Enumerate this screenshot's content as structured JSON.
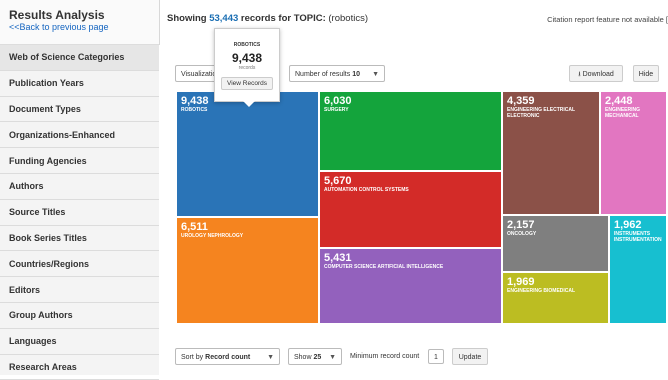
{
  "sidebar": {
    "title": "Results Analysis",
    "back_link": "<<Back to previous page",
    "items": [
      {
        "label": "Web of Science Categories",
        "active": true
      },
      {
        "label": "Publication Years"
      },
      {
        "label": "Document Types"
      },
      {
        "label": "Organizations-Enhanced"
      },
      {
        "label": "Funding Agencies"
      },
      {
        "label": "Authors"
      },
      {
        "label": "Source Titles"
      },
      {
        "label": "Book Series Titles"
      },
      {
        "label": "Countries/Regions"
      },
      {
        "label": "Editors"
      },
      {
        "label": "Group Authors"
      },
      {
        "label": "Languages"
      },
      {
        "label": "Research Areas"
      }
    ]
  },
  "header": {
    "prefix": "Showing",
    "count": "53,443",
    "middle": "records for TOPIC:",
    "query": "(robotics)",
    "note": "Citation report feature not available ["
  },
  "toolbar": {
    "visualization_label": "Visualizatio",
    "results_label": "Number of results",
    "results_value": "10",
    "download_label": "Download",
    "hide_label": "Hide"
  },
  "tooltip": {
    "category": "ROBOTICS",
    "value": "9,438",
    "unit": "records",
    "button": "View Records"
  },
  "treemap": [
    {
      "value": "9,438",
      "label": "ROBOTICS",
      "color": "#2a74b7"
    },
    {
      "value": "6,511",
      "label": "UROLOGY NEPHROLOGY",
      "color": "#f5841f"
    },
    {
      "value": "6,030",
      "label": "SURGERY",
      "color": "#14a43c"
    },
    {
      "value": "5,670",
      "label": "AUTOMATION CONTROL SYSTEMS",
      "color": "#d32b28"
    },
    {
      "value": "5,431",
      "label": "COMPUTER SCIENCE ARTIFICIAL INTELLIGENCE",
      "color": "#9361bd"
    },
    {
      "value": "4,359",
      "label": "ENGINEERING ELECTRICAL ELECTRONIC",
      "color": "#8b5148"
    },
    {
      "value": "2,448",
      "label": "ENGINEERING MECHANICAL",
      "color": "#e276c1"
    },
    {
      "value": "2,157",
      "label": "ONCOLOGY",
      "color": "#7f7f7f"
    },
    {
      "value": "1,962",
      "label": "INSTRUMENTS INSTRUMENTATION",
      "color": "#17bfd0"
    },
    {
      "value": "1,969",
      "label": "ENGINEERING BIOMEDICAL",
      "color": "#bcbd22"
    }
  ],
  "bottom": {
    "sort_prefix": "Sort by",
    "sort_value": "Record count",
    "show_prefix": "Show",
    "show_value": "25",
    "min_label": "Minimum record count",
    "min_value": "1",
    "update_label": "Update"
  }
}
